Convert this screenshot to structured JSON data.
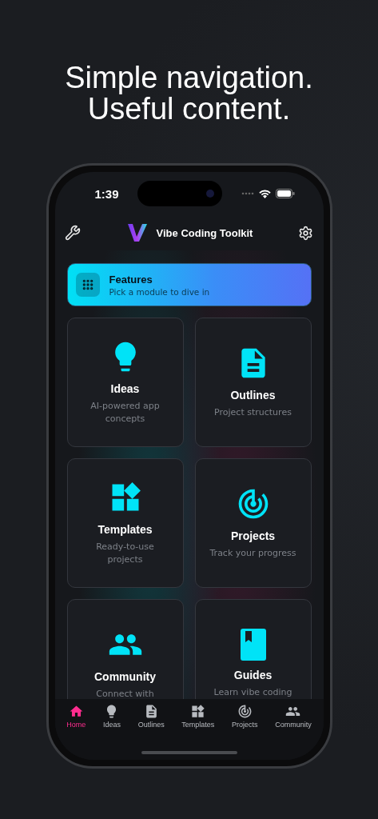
{
  "headline": "Simple navigation. Useful content.",
  "status_bar": {
    "time": "1:39"
  },
  "header": {
    "title": "Vibe Coding Toolkit"
  },
  "banner": {
    "title": "Features",
    "subtitle": "Pick a module to dive in"
  },
  "cards": [
    {
      "kind": "ideas",
      "title": "Ideas",
      "subtitle": "AI-powered app concepts"
    },
    {
      "kind": "outlines",
      "title": "Outlines",
      "subtitle": "Project structures"
    },
    {
      "kind": "templates",
      "title": "Templates",
      "subtitle": "Ready-to-use projects"
    },
    {
      "kind": "projects",
      "title": "Projects",
      "subtitle": "Track your progress"
    },
    {
      "kind": "community",
      "title": "Community",
      "subtitle": "Connect with"
    },
    {
      "kind": "guides",
      "title": "Guides",
      "subtitle": "Learn vibe coding"
    }
  ],
  "tab_bar": [
    {
      "kind": "home",
      "label": "Home",
      "selected": true
    },
    {
      "kind": "ideas",
      "label": "Ideas",
      "selected": false
    },
    {
      "kind": "outlines",
      "label": "Outlines",
      "selected": false
    },
    {
      "kind": "templates",
      "label": "Templates",
      "selected": false
    },
    {
      "kind": "projects",
      "label": "Projects",
      "selected": false
    },
    {
      "kind": "community",
      "label": "Community",
      "selected": false
    }
  ]
}
